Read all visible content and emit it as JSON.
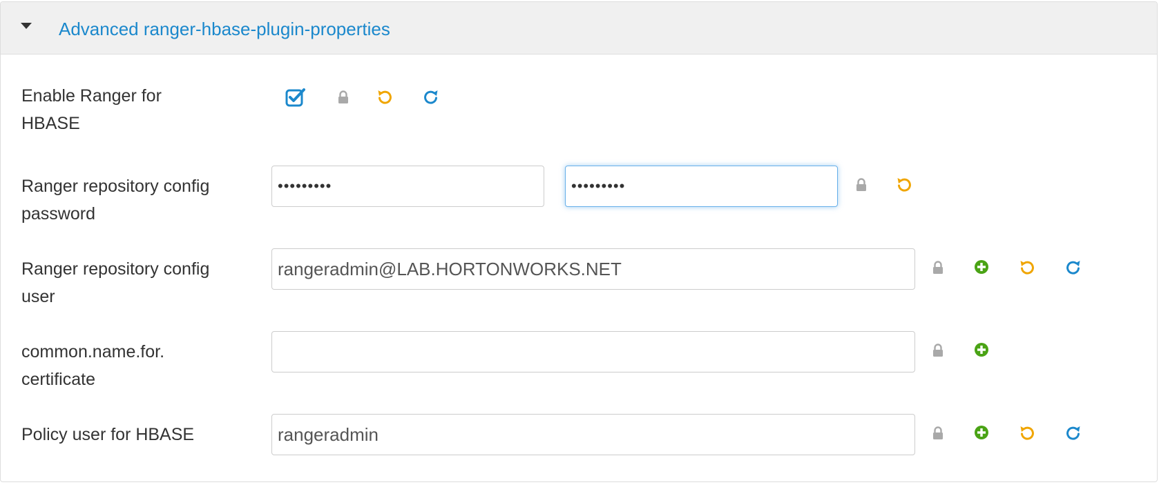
{
  "section": {
    "title": "Advanced ranger-hbase-plugin-properties",
    "collapse_icon": "caret-down-icon"
  },
  "colors": {
    "link": "#1b88cc",
    "lock": "#a9a9a9",
    "undo": "#f0a500",
    "refresh": "#1b88cc",
    "add": "#4aa315"
  },
  "icons": {
    "lock": "lock-icon",
    "undo": "undo-icon",
    "refresh": "refresh-icon",
    "add": "plus-circle-icon",
    "checkbox": "checkbox-checked-icon"
  },
  "properties": {
    "enable_ranger": {
      "label_line1": "Enable Ranger for",
      "label_line2": "HBASE",
      "checked": true
    },
    "repo_password": {
      "label_line1": "Ranger repository config",
      "label_line2": "password",
      "value": "•••••••••",
      "confirm_value": "•••••••••"
    },
    "repo_user": {
      "label_line1": "Ranger repository config",
      "label_line2": "user",
      "value": "rangeradmin@LAB.HORTONWORKS.NET"
    },
    "common_name": {
      "label_line1": "common.name.for.",
      "label_line2": "certificate",
      "value": ""
    },
    "policy_user": {
      "label_line1": "Policy user for HBASE",
      "value": "rangeradmin"
    }
  }
}
